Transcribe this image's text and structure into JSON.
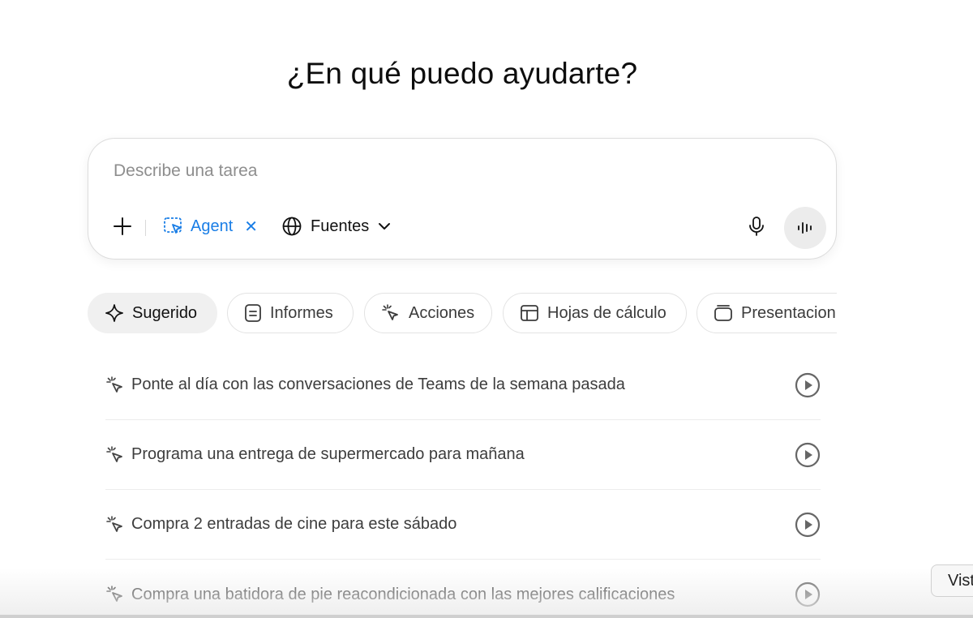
{
  "heading": "¿En qué puedo ayudarte?",
  "composer": {
    "placeholder": "Describe una tarea",
    "agent_label": "Agent",
    "agent_close": "✕",
    "sources_label": "Fuentes"
  },
  "chips": [
    {
      "label": "Sugerido",
      "icon": "sparkle-icon",
      "active": true
    },
    {
      "label": "Informes",
      "icon": "document-icon",
      "active": false
    },
    {
      "label": "Acciones",
      "icon": "agent-cursor-icon",
      "active": false
    },
    {
      "label": "Hojas de cálculo",
      "icon": "spreadsheet-icon",
      "active": false
    },
    {
      "label": "Presentacion",
      "icon": "slides-icon",
      "active": false
    }
  ],
  "suggestions": [
    {
      "text": "Ponte al día con las conversaciones de Teams de la semana pasada"
    },
    {
      "text": "Programa una entrega de supermercado para mañana"
    },
    {
      "text": "Compra 2 entradas de cine para este sábado"
    },
    {
      "text": "Compra una batidora de pie reacondicionada con las mejores calificaciones"
    }
  ],
  "corner_button": "Vist",
  "colors": {
    "accent": "#1a7ee6",
    "chip_active_bg": "#f0f0f0",
    "border": "#dcdcdc"
  }
}
